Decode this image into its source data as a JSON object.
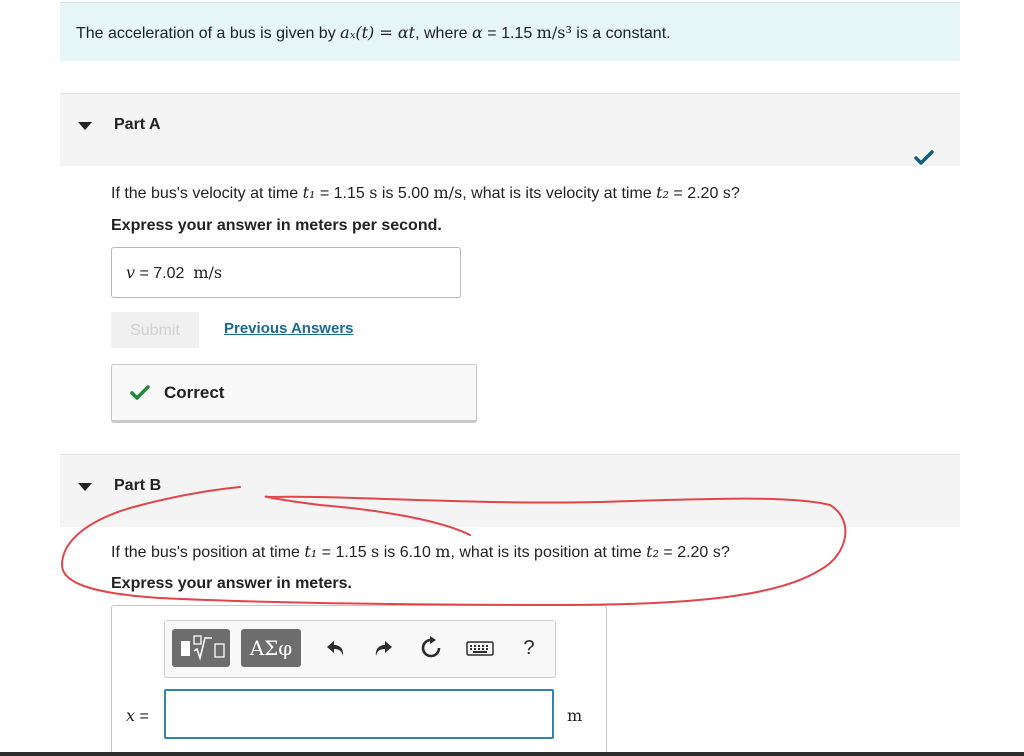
{
  "problem": {
    "intro": "The acceleration of a bus is given by ",
    "formula": "aₓ(t) = αt",
    "mid": ", where ",
    "alpha_symbol": "α",
    "eq": " = ",
    "alpha_value": "1.15",
    "alpha_unit": "m/s³",
    "outro": " is a constant."
  },
  "part_a": {
    "title": "Part A",
    "q_prefix": "If the bus's velocity at time ",
    "t1_symbol": "t₁",
    "t1_eq": " = 1.15 ",
    "t1_unit": "s",
    "q_mid": " is 5.00 ",
    "v_unit": "m/s",
    "q_mid2": ", what is its velocity at time ",
    "t2_symbol": "t₂",
    "t2_eq": " = 2.20 ",
    "t2_unit": "s",
    "q_end": "?",
    "instruction": "Express your answer in meters per second.",
    "answer_label": "v",
    "answer_eq": " = ",
    "answer_value": "7.02",
    "answer_unit": "m/s",
    "submit_label": "Submit",
    "previous_label": "Previous Answers",
    "result_label": "Correct"
  },
  "part_b": {
    "title": "Part B",
    "q_prefix": "If the bus's position at time ",
    "t1_symbol": "t₁",
    "t1_eq": " = 1.15 ",
    "t1_unit": "s",
    "q_mid": " is 6.10 ",
    "x_unit": "m",
    "q_mid2": ", what is its position at time ",
    "t2_symbol": "t₂",
    "t2_eq": " = 2.20 ",
    "t2_unit": "s",
    "q_end": "?",
    "instruction": "Express your answer in meters.",
    "answer_label": "x",
    "answer_eq": " =",
    "answer_value": "",
    "answer_unit": "m",
    "toolbar": {
      "greek_label": "ΑΣφ",
      "help_label": "?"
    }
  },
  "colors": {
    "problem_bg": "#e6f5f6",
    "check_green": "#1f8a3b",
    "link_blue": "#1a6b8f",
    "input_border": "#2f86a6",
    "annotation_red": "#e0454c"
  }
}
